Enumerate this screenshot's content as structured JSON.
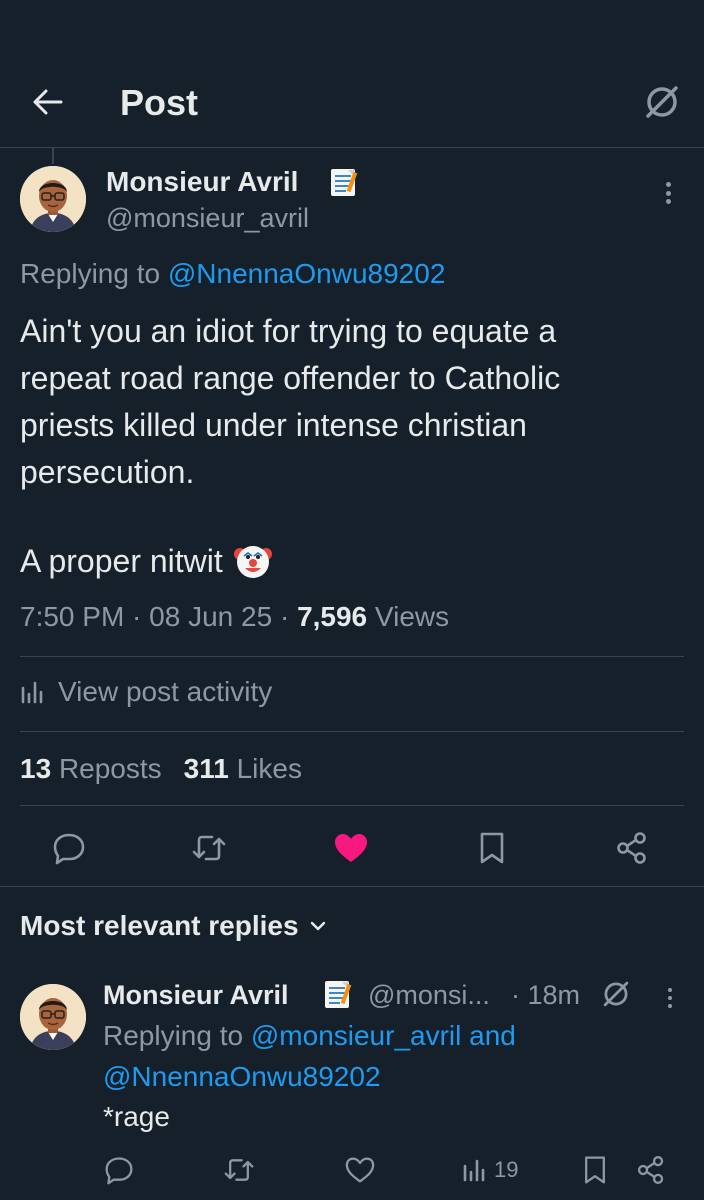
{
  "header": {
    "title": "Post"
  },
  "post": {
    "author_name": "Monsieur Avril",
    "author_handle": "@monsieur_avril",
    "replying_prefix": "Replying to",
    "replying_to": "@NnennaOnwu89202",
    "text": "Ain't you an idiot for trying to equate a\nrepeat road range offender to Catholic\npriests killed under intense christian\npersecution.",
    "closing_text": "A proper nitwit",
    "time": "7:50 PM",
    "date": "08 Jun 25",
    "views_count": "7,596",
    "views_label": "Views",
    "activity_label": "View post activity",
    "reposts_count": "13",
    "reposts_label": "Reposts",
    "likes_count": "311",
    "likes_label": "Likes",
    "liked": true
  },
  "replies_section": {
    "sort_label": "Most relevant replies"
  },
  "reply": {
    "author_name": "Monsieur Avril",
    "author_handle": "@monsi...",
    "time": "· 18m",
    "replying_prefix": "Replying to",
    "replying_to_1": "@monsieur_avril",
    "replying_and": "and",
    "replying_to_2": "@NnennaOnwu89202",
    "text": "*rage",
    "views_count": "19"
  },
  "colors": {
    "background": "#15202b",
    "text": "#e7e9ea",
    "muted": "#8b98a5",
    "link": "#1d9bf0",
    "like": "#f91880",
    "border": "#38444d"
  },
  "icons": [
    "back-arrow-icon",
    "grok-icon",
    "more-dots-icon",
    "memo-emoji-icon",
    "clown-emoji-icon",
    "analytics-icon",
    "reply-icon",
    "repost-icon",
    "heart-icon",
    "bookmark-icon",
    "share-icon",
    "chevron-down-icon"
  ]
}
